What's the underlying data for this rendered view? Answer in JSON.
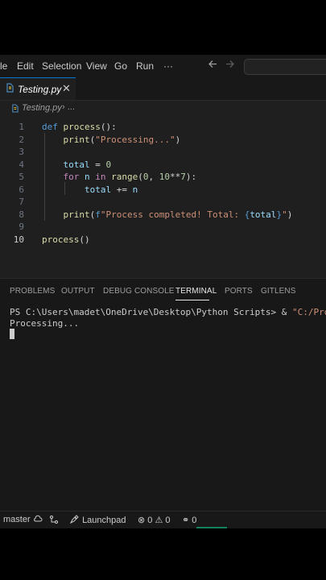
{
  "menu": {
    "items": [
      "le",
      "Edit",
      "Selection",
      "View",
      "Go",
      "Run",
      "···"
    ],
    "back_icon": "arrow-left-icon",
    "forward_icon": "arrow-right-icon"
  },
  "tab": {
    "label": "Testing.py",
    "close": "✕"
  },
  "breadcrumb": {
    "file": "Testing.py",
    "sep": "› ..."
  },
  "editor": {
    "line_numbers": [
      "1",
      "2",
      "3",
      "4",
      "5",
      "6",
      "7",
      "8",
      "9",
      "10"
    ],
    "active_line": 10
  },
  "panel": {
    "tabs": [
      "PROBLEMS",
      "OUTPUT",
      "DEBUG CONSOLE",
      "TERMINAL",
      "PORTS",
      "GITLENS"
    ],
    "active_tab": "TERMINAL",
    "terminal_prompt": "PS C:\\Users\\madet\\OneDrive\\Desktop\\Python Scripts> & ",
    "terminal_path": "\"C:/Program F",
    "terminal_output": "Processing..."
  },
  "status": {
    "branch": "master",
    "launchpad": "Launchpad",
    "errors": "0",
    "warnings": "0",
    "ports": "0"
  },
  "colors": {
    "accent": "#0078d4",
    "background": "#1f1f1f"
  }
}
